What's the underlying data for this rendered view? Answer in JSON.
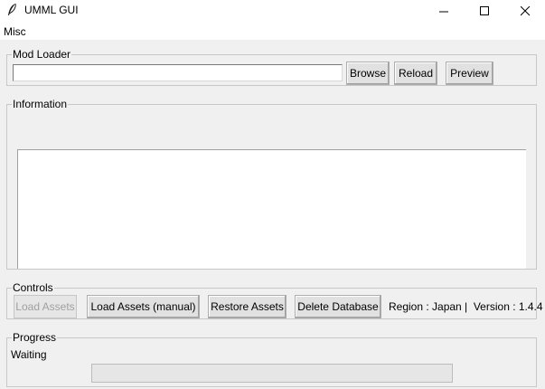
{
  "window": {
    "title": "UMML GUI",
    "icon": "feather-icon",
    "controls": [
      "minimize-icon",
      "maximize-icon",
      "close-icon"
    ]
  },
  "menubar": {
    "items": [
      {
        "label": "Misc"
      }
    ]
  },
  "mod_loader": {
    "label": "Mod Loader",
    "path_value": "",
    "browse_label": "Browse",
    "reload_label": "Reload",
    "preview_label": "Preview"
  },
  "information": {
    "label": "Information",
    "text": ""
  },
  "controls": {
    "label": "Controls",
    "load_assets_label": "Load Assets",
    "load_assets_enabled": false,
    "load_assets_manual_label": "Load Assets (manual)",
    "restore_assets_label": "Restore Assets",
    "delete_database_label": "Delete Database",
    "status_text": "Region : Japan |  Version : 1.4.4"
  },
  "progress": {
    "label": "Progress",
    "status": "Waiting",
    "value_percent": 0
  }
}
